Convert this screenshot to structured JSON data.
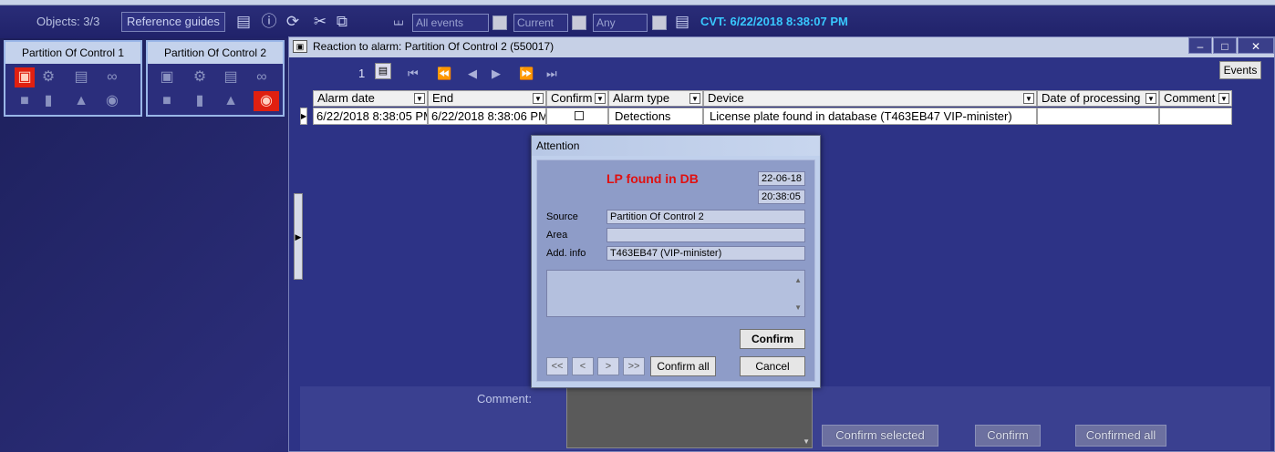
{
  "toolbar": {
    "objects": "Objects: 3/3",
    "reference_guides": "Reference guides",
    "filter_events": "All events",
    "filter_current": "Current",
    "filter_any": "Any",
    "cvt": "CVT: 6/22/2018 8:38:07 PM"
  },
  "partitions": [
    {
      "title": "Partition  Of Control 1"
    },
    {
      "title": "Partition  Of Control 2"
    }
  ],
  "reaction_window": {
    "title": "Reaction to alarm: Partition  Of Control 2 (550017)",
    "page_number": "1",
    "events_button": "Events",
    "columns": [
      "Alarm date",
      "End",
      "Confirm",
      "Alarm type",
      "Device",
      "Date of processing",
      "Comment"
    ],
    "row": {
      "alarm_date": "6/22/2018 8:38:05 PM",
      "end": "6/22/2018 8:38:06 PM",
      "alarm_type": "Detections",
      "device": "License plate found in database (T463EB47 VIP-minister)"
    },
    "comment_label": "Comment:",
    "confirm_selected": "Confirm selected",
    "confirm": "Confirm",
    "confirmed_all": "Confirmed all"
  },
  "dialog": {
    "title": "Attention",
    "heading": "LP found in DB",
    "date": "22-06-18",
    "time": "20:38:05",
    "source_label": "Source",
    "source_value": "Partition  Of Control 2",
    "area_label": "Area",
    "area_value": "",
    "addinfo_label": "Add. info",
    "addinfo_value": "T463EB47 (VIP-minister)",
    "confirm": "Confirm",
    "confirm_all": "Confirm all",
    "cancel": "Cancel",
    "nav_first": "<<",
    "nav_prev": "<",
    "nav_next": ">",
    "nav_last": ">>"
  },
  "colors": {
    "accent": "#38c8ff",
    "alarm_red": "#e01010",
    "background": "#24266a"
  }
}
